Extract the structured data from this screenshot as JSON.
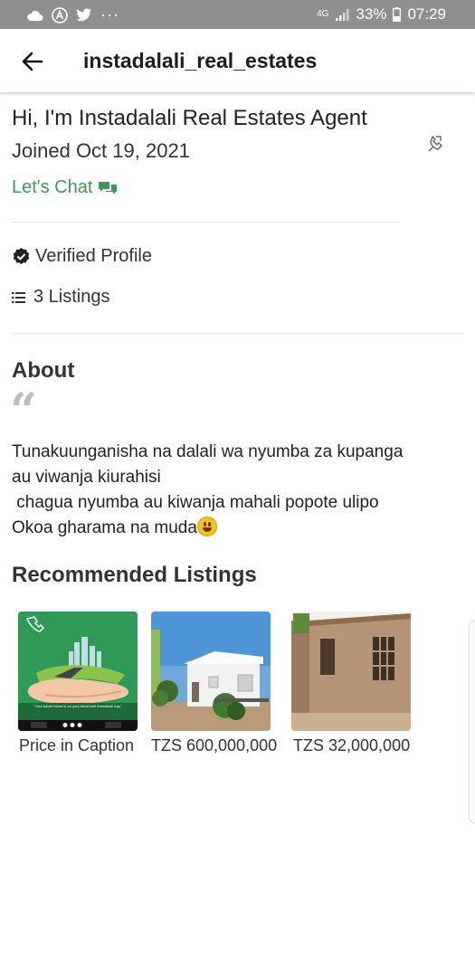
{
  "status_bar": {
    "network": "4G",
    "battery": "33%",
    "time": "07:29",
    "more": "···"
  },
  "app_bar": {
    "title": "instadalali_real_estates"
  },
  "profile": {
    "greeting": "Hi, I'm Instadalali Real Estates Agent",
    "joined": "Joined Oct 19, 2021",
    "chat_label": "Let's Chat",
    "verified_label": "Verified Profile",
    "listings_label": "3 Listings"
  },
  "about": {
    "heading": "About",
    "quote_mark": "“",
    "lines": [
      "Tunakuunganisha na dalali wa nyumba za kupanga",
      "au viwanja kiurahisi",
      " chagua nyumba au kiwanja mahali popote ulipo",
      "Okoa gharama na muda"
    ]
  },
  "recommended": {
    "heading": "Recommended Listings",
    "items": [
      {
        "price": "Price in Caption",
        "image": "instadalali-ad",
        "caption": "\"Your future home is on your hand with Instadalali App\""
      },
      {
        "price": "TZS 600,000,000",
        "image": "white-house"
      },
      {
        "price": "TZS 32,000,000",
        "image": "unfinished-house"
      }
    ]
  },
  "colors": {
    "status_bar": "#8f8f8f",
    "accent_green": "#3d9a59",
    "ad_green": "#2f9a57"
  }
}
